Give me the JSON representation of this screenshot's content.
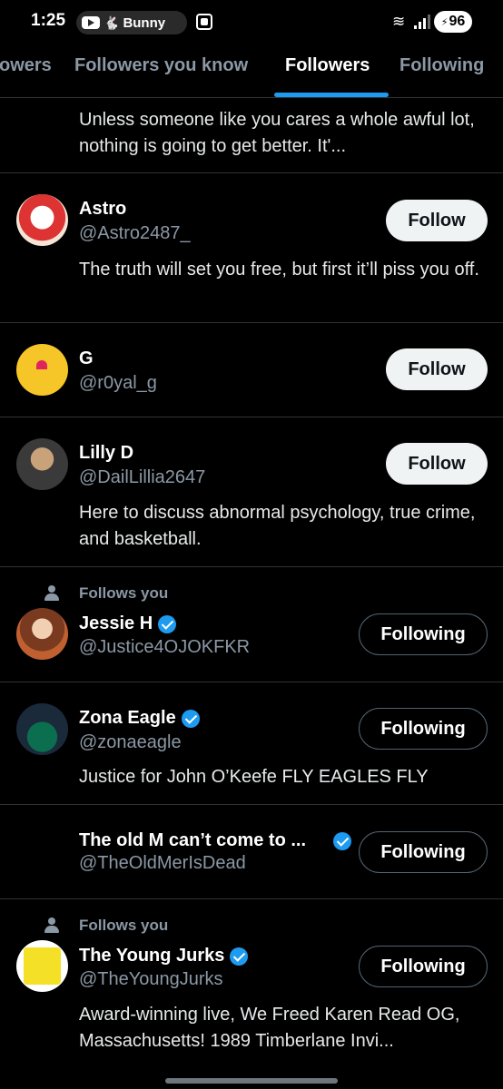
{
  "status_bar": {
    "time": "1:25",
    "media_label": "Bunny",
    "wifi_label": "5",
    "battery": "96"
  },
  "tabs": [
    {
      "label": "owers"
    },
    {
      "label": "Followers you know"
    },
    {
      "label": "Followers",
      "active": true
    },
    {
      "label": "Following"
    }
  ],
  "top_bio": "Unless someone like you cares a whole awful lot, nothing is going to get better. It'...",
  "users": [
    {
      "name": "Astro",
      "handle": "@Astro2487_",
      "button": "Follow",
      "bio": "The truth will set you free, but first it’ll piss you off."
    },
    {
      "name": "G",
      "handle": "@r0yal_g",
      "button": "Follow"
    },
    {
      "name": "Lilly D",
      "handle": "@DailLillia2647",
      "button": "Follow",
      "bio": "Here to discuss abnormal psychology, true crime, and basketball."
    },
    {
      "follows_you": "Follows you",
      "name": "Jessie H",
      "verified": true,
      "handle": "@Justice4OJOKFKR",
      "button": "Following"
    },
    {
      "name": "Zona Eagle",
      "verified": true,
      "handle": "@zonaeagle",
      "button": "Following",
      "bio": "Justice for John O’Keefe FLY EAGLES FLY"
    },
    {
      "name": "The old M can’t come to ...",
      "verified": true,
      "handle": "@TheOldMerIsDead",
      "button": "Following"
    },
    {
      "follows_you": "Follows you",
      "name": "The Young Jurks",
      "verified": true,
      "handle": "@TheYoungJurks",
      "button": "Following",
      "bio": "Award-winning live, We Freed Karen Read OG, Massachusetts! 1989 Timberlane Invi..."
    }
  ],
  "colors": {
    "accent": "#1d9bf0",
    "background": "#000000",
    "secondary_text": "#8b98a5"
  }
}
